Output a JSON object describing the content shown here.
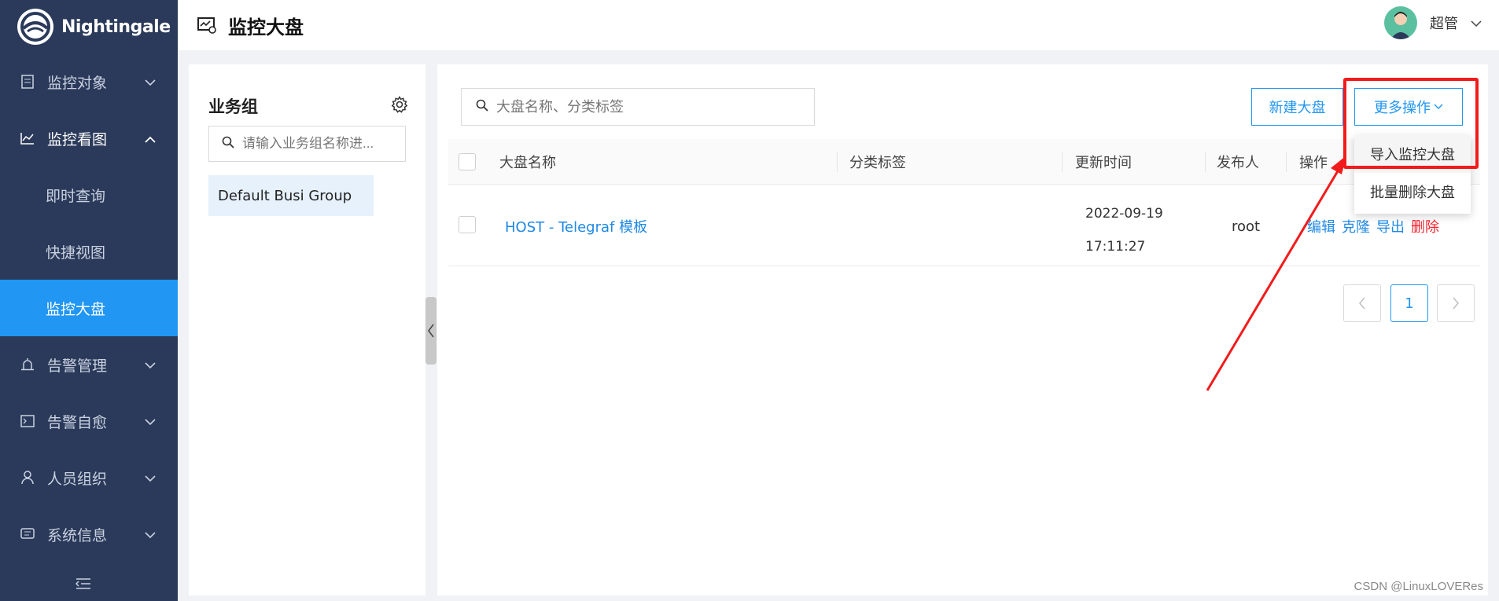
{
  "app": {
    "name": "Nightingale"
  },
  "sidebar": {
    "items": [
      {
        "label": "监控对象"
      },
      {
        "label": "监控看图"
      },
      {
        "label": "即时查询"
      },
      {
        "label": "快捷视图"
      },
      {
        "label": "监控大盘"
      },
      {
        "label": "告警管理"
      },
      {
        "label": "告警自愈"
      },
      {
        "label": "人员组织"
      },
      {
        "label": "系统信息"
      }
    ]
  },
  "header": {
    "title": "监控大盘",
    "user_name": "超管"
  },
  "business_group": {
    "title": "业务组",
    "search_placeholder": "请输入业务组名称进...",
    "groups": [
      "Default Busi Group"
    ]
  },
  "toolbar": {
    "search_placeholder": "大盘名称、分类标签",
    "new_button": "新建大盘",
    "more_button": "更多操作"
  },
  "dropdown": {
    "items": [
      "导入监控大盘",
      "批量删除大盘"
    ]
  },
  "table": {
    "columns": [
      "大盘名称",
      "分类标签",
      "更新时间",
      "发布人",
      "操作"
    ],
    "rows": [
      {
        "name": "HOST - Telegraf 模板",
        "tags": "",
        "date": "2022-09-19",
        "time": "17:11:27",
        "publisher": "root",
        "actions": {
          "edit": "编辑",
          "clone": "克隆",
          "export": "导出",
          "delete": "删除"
        }
      }
    ]
  },
  "pagination": {
    "current": "1"
  },
  "watermark": "CSDN @LinuxLOVERes",
  "colors": {
    "sidebar_bg": "#2b3a5a",
    "accent": "#2196f3",
    "highlight": "#f21b1b",
    "danger": "#f5222d"
  }
}
